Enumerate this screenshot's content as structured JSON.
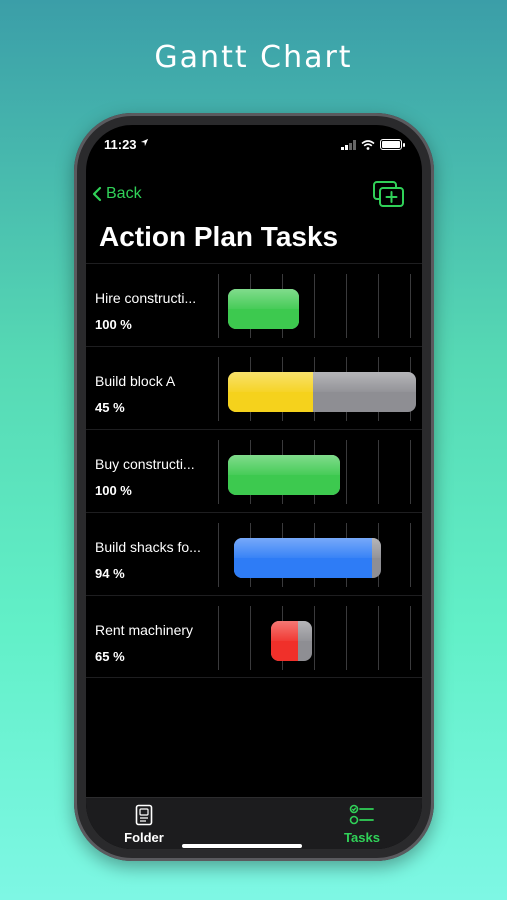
{
  "promo": {
    "title": "Gantt Chart"
  },
  "status_bar": {
    "time": "11:23"
  },
  "nav": {
    "back_label": "Back",
    "title": "Action Plan Tasks"
  },
  "tasks": [
    {
      "name": "Hire constructi...",
      "percent_label": "100 %",
      "progress": 1.0,
      "start": 0.05,
      "end": 0.4,
      "color": "#3dc94f"
    },
    {
      "name": "Build block A",
      "percent_label": "45 %",
      "progress": 0.45,
      "start": 0.05,
      "end": 0.97,
      "color": "#f5d21c"
    },
    {
      "name": "Buy constructi...",
      "percent_label": "100 %",
      "progress": 1.0,
      "start": 0.05,
      "end": 0.6,
      "color": "#3dc94f"
    },
    {
      "name": "Build shacks fo...",
      "percent_label": "94 %",
      "progress": 0.94,
      "start": 0.08,
      "end": 0.8,
      "color": "#2e7cf6"
    },
    {
      "name": "Rent machinery",
      "percent_label": "65 %",
      "progress": 0.65,
      "start": 0.26,
      "end": 0.46,
      "color": "#f0302a"
    }
  ],
  "tab_bar": {
    "items": [
      {
        "label": "Folder",
        "icon": "folder-doc-icon",
        "active": false
      },
      {
        "label": "Tasks",
        "icon": "checklist-icon",
        "active": true
      }
    ]
  },
  "colors": {
    "accent": "#30d158",
    "remaining": "#8e8e93"
  }
}
